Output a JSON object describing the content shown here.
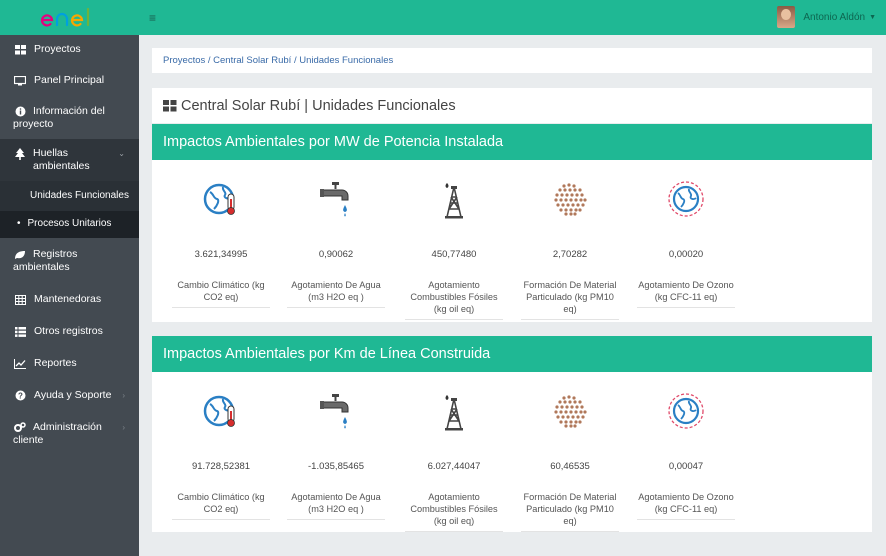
{
  "logo": {
    "text": "enel",
    "colors": [
      "#e4007f",
      "#00a0df",
      "#f7a600",
      "#6db33f"
    ]
  },
  "sidebar": {
    "items": [
      {
        "label": "Proyectos",
        "icon": "grid-icon"
      },
      {
        "label": "Panel Principal",
        "icon": "monitor-icon"
      },
      {
        "label": "Información del proyecto",
        "icon": "info-icon"
      },
      {
        "label": "Huellas ambientales",
        "icon": "tree-icon"
      },
      {
        "label": "Registros ambientales",
        "icon": "leaf-icon"
      },
      {
        "label": "Mantenedoras",
        "icon": "table-icon"
      },
      {
        "label": "Otros registros",
        "icon": "list-icon"
      },
      {
        "label": "Reportes",
        "icon": "chart-line-icon"
      },
      {
        "label": "Ayuda y Soporte",
        "icon": "question-icon"
      },
      {
        "label": "Administración cliente",
        "icon": "cogs-icon"
      }
    ],
    "subitems": [
      {
        "label": "Unidades Funcionales"
      },
      {
        "label": "Procesos Unitarios"
      }
    ]
  },
  "topbar": {
    "menu_icon": "≡",
    "user_name": "Antonio Aldón"
  },
  "breadcrumb": "Proyectos / Central Solar Rubí / Unidades Funcionales",
  "page_title": "Central Solar Rubí | Unidades Funcionales",
  "sections": [
    {
      "title": "Impactos Ambientales por MW de Potencia Instalada",
      "cards": [
        {
          "value": "3.621,34995",
          "label": "Cambio Climático (kg CO2 eq)",
          "icon": "earth-thermometer-icon"
        },
        {
          "value": "0,90062",
          "label": "Agotamiento De Agua (m3 H2O eq )",
          "icon": "faucet-icon"
        },
        {
          "value": "450,77480",
          "label": "Agotamiento Combustibles Fósiles (kg oil eq)",
          "icon": "oil-derrick-icon"
        },
        {
          "value": "2,70282",
          "label": "Formación De Material Particulado (kg PM10 eq)",
          "icon": "particles-icon"
        },
        {
          "value": "0,00020",
          "label": "Agotamiento De Ozono (kg CFC-11 eq)",
          "icon": "ozone-earth-icon"
        }
      ]
    },
    {
      "title": "Impactos Ambientales por Km de Línea Construida",
      "cards": [
        {
          "value": "91.728,52381",
          "label": "Cambio Climático (kg CO2 eq)",
          "icon": "earth-thermometer-icon"
        },
        {
          "value": "-1.035,85465",
          "label": "Agotamiento De Agua (m3 H2O eq )",
          "icon": "faucet-icon"
        },
        {
          "value": "6.027,44047",
          "label": "Agotamiento Combustibles Fósiles (kg oil eq)",
          "icon": "oil-derrick-icon"
        },
        {
          "value": "60,46535",
          "label": "Formación De Material Particulado (kg PM10 eq)",
          "icon": "particles-icon"
        },
        {
          "value": "0,00047",
          "label": "Agotamiento De Ozono (kg CFC-11 eq)",
          "icon": "ozone-earth-icon"
        }
      ]
    }
  ],
  "colors": {
    "accent": "#1fb894",
    "sidebar": "#434a51",
    "link": "#3a6ba8"
  }
}
